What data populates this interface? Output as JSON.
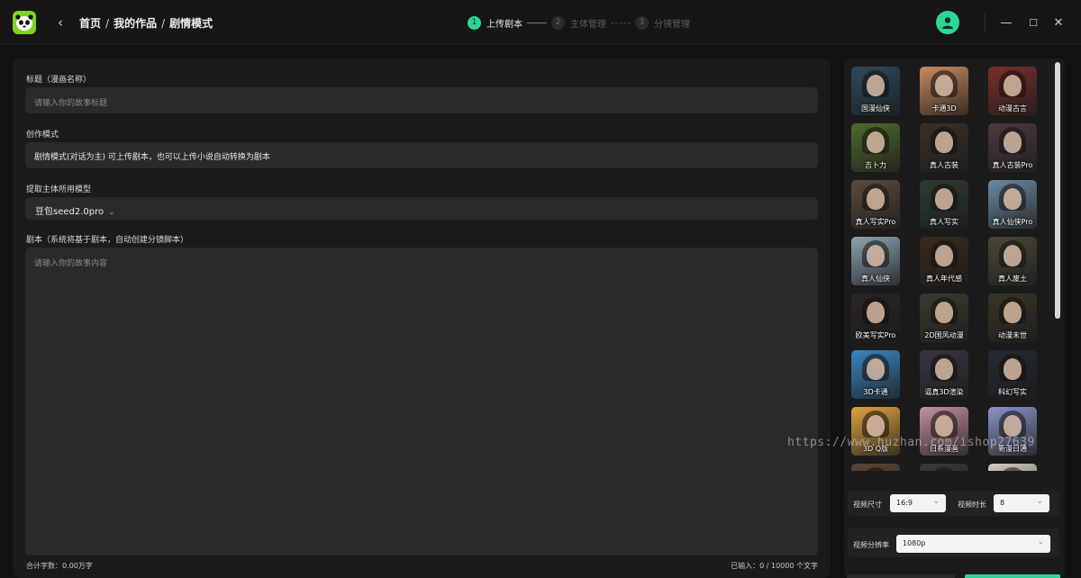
{
  "header": {
    "breadcrumb": [
      "首页",
      "我的作品",
      "剧情模式"
    ],
    "breadcrumb_sep": "/",
    "steps": [
      {
        "num": "1",
        "label": "上传剧本",
        "active": true
      },
      {
        "num": "2",
        "label": "主体管理",
        "active": false
      },
      {
        "num": "3",
        "label": "分镜管理",
        "active": false
      }
    ],
    "window_buttons": {
      "minimize": "—",
      "maximize": "☐",
      "close": "✕"
    }
  },
  "form": {
    "title_label": "标题（漫画名称）",
    "title_placeholder": "请输入你的故事标题",
    "mode_label": "创作模式",
    "mode_value": "剧情模式(对话为主) 可上传剧本，也可以上传小说自动转换为剧本",
    "model_label": "提取主体所用模型",
    "model_value": "豆包seed2.0pro",
    "script_label": "剧本（系统将基于剧本，自动创建分镜脚本）",
    "script_placeholder": "请输入你的故事内容",
    "total_words": "合计字数：0.00万字",
    "entered": "已输入：0 / 10000 个文字"
  },
  "styles": [
    {
      "label": "国漫仙侠",
      "bg": "#2d4a5c"
    },
    {
      "label": "卡通3D",
      "bg": "#c98a5d"
    },
    {
      "label": "动漫古言",
      "bg": "#7a2e2a"
    },
    {
      "label": "吉卜力",
      "bg": "#4f6b2d"
    },
    {
      "label": "真人古装",
      "bg": "#3a3028"
    },
    {
      "label": "真人古装Pro",
      "bg": "#4b3a3e"
    },
    {
      "label": "真人写实Pro",
      "bg": "#5c4a3e"
    },
    {
      "label": "真人写实",
      "bg": "#2e3b30"
    },
    {
      "label": "真人仙侠Pro",
      "bg": "#6d8aa3"
    },
    {
      "label": "真人仙侠",
      "bg": "#8da3b0"
    },
    {
      "label": "真人年代感",
      "bg": "#3a2a1c"
    },
    {
      "label": "真人废土",
      "bg": "#4a4638"
    },
    {
      "label": "欧美写实Pro",
      "bg": "#2b2624"
    },
    {
      "label": "2D国风动漫",
      "bg": "#3c3a30"
    },
    {
      "label": "动漫末世",
      "bg": "#3b3528"
    },
    {
      "label": "3D卡通",
      "bg": "#3a87c4"
    },
    {
      "label": "逼真3D渲染",
      "bg": "#3a3440"
    },
    {
      "label": "科幻写实",
      "bg": "#252a33"
    },
    {
      "label": "3D Q版",
      "bg": "#e0a340"
    },
    {
      "label": "日系漫画",
      "bg": "#c58fa0"
    },
    {
      "label": "新漫日通",
      "bg": "#8a94c9"
    },
    {
      "label": "",
      "bg": "#5a4636"
    },
    {
      "label": "",
      "bg": "#3a3a3a"
    },
    {
      "label": "",
      "bg": "#d8d0c0"
    }
  ],
  "settings": {
    "size_label": "视频尺寸",
    "size_value": "16:9",
    "duration_label": "视频时长",
    "duration_value": "8",
    "resolution_label": "视频分辨率",
    "resolution_value": "1080p"
  },
  "watermark": "https://www.huzhan.com/ishop27639",
  "colors": {
    "accent": "#2fd596",
    "logo": "#7ed321"
  }
}
